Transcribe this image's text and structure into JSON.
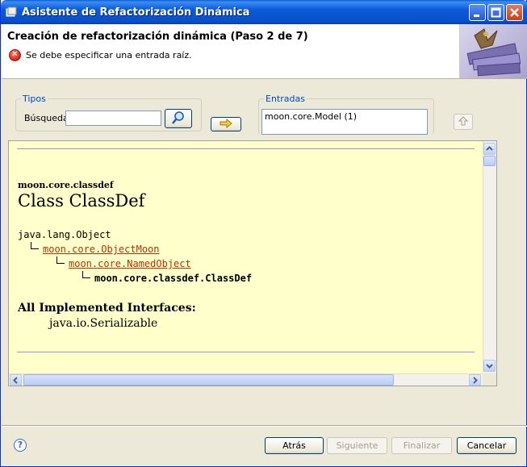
{
  "window": {
    "title": "Asistente de Refactorización Dinámica"
  },
  "header": {
    "title": "Creación de refactorización dinámica (Paso 2 de 7)",
    "error_message": "Se debe especificar una entrada raíz."
  },
  "types_group": {
    "label": "Tipos",
    "search_label": "Búsqueda:",
    "search_value": ""
  },
  "entries_group": {
    "label": "Entradas",
    "items": [
      "moon.core.Model (1)"
    ]
  },
  "doc": {
    "package": "moon.core.classdef",
    "class_title": "Class ClassDef",
    "hierarchy": [
      "java.lang.Object",
      "moon.core.ObjectMoon",
      "moon.core.NamedObject",
      "moon.core.classdef.ClassDef"
    ],
    "interfaces_heading": "All Implemented Interfaces:",
    "interfaces": "java.io.Serializable"
  },
  "buttons": {
    "back": "Atrás",
    "next": "Siguiente",
    "finish": "Finalizar",
    "cancel": "Cancelar"
  },
  "icons": {
    "search": "magnifier-icon",
    "add": "arrow-right-icon",
    "up": "arrow-up-icon",
    "help": "help-icon",
    "error": "error-icon"
  },
  "colors": {
    "link": "#c02f00",
    "doc_bg": "#ffffcc",
    "title_bar": "#0a5fd6",
    "group_label": "#0046d5"
  }
}
